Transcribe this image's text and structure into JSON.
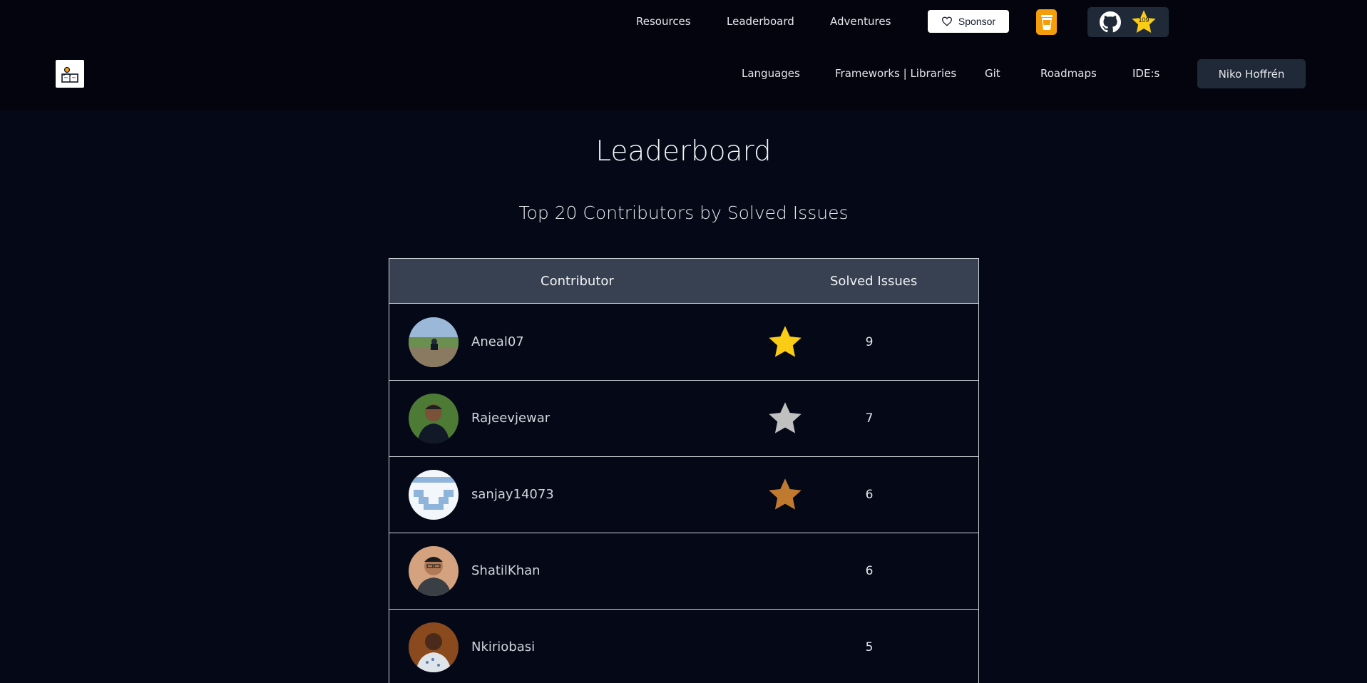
{
  "top_nav": {
    "links": [
      "Resources",
      "Leaderboard",
      "Adventures"
    ],
    "sponsor_label": "Sponsor",
    "github_stars": "109"
  },
  "main_nav": {
    "links": [
      "Languages",
      "Frameworks | Libraries",
      "Git",
      "Roadmaps",
      "IDE:s"
    ],
    "user_label": "Niko Hoffrén"
  },
  "page": {
    "title": "Leaderboard",
    "subtitle": "Top 20 Contributors by Solved Issues"
  },
  "table": {
    "headers": {
      "contributor": "Contributor",
      "solved": "Solved Issues"
    },
    "rows": [
      {
        "name": "Aneal07",
        "solved": "9",
        "medal": "gold"
      },
      {
        "name": "Rajeevjewar",
        "solved": "7",
        "medal": "silver"
      },
      {
        "name": "sanjay14073",
        "solved": "6",
        "medal": "bronze"
      },
      {
        "name": "ShatilKhan",
        "solved": "6",
        "medal": ""
      },
      {
        "name": "Nkiriobasi",
        "solved": "5",
        "medal": ""
      }
    ]
  },
  "colors": {
    "gold": "#facc15",
    "silver": "#c0c0c0",
    "bronze": "#c07a30",
    "accent_coffee": "#f59e0b"
  },
  "icons": [
    "heart-icon",
    "coffee-cup-icon",
    "github-icon",
    "star-icon",
    "logo-icon",
    "medal-star-icon"
  ]
}
